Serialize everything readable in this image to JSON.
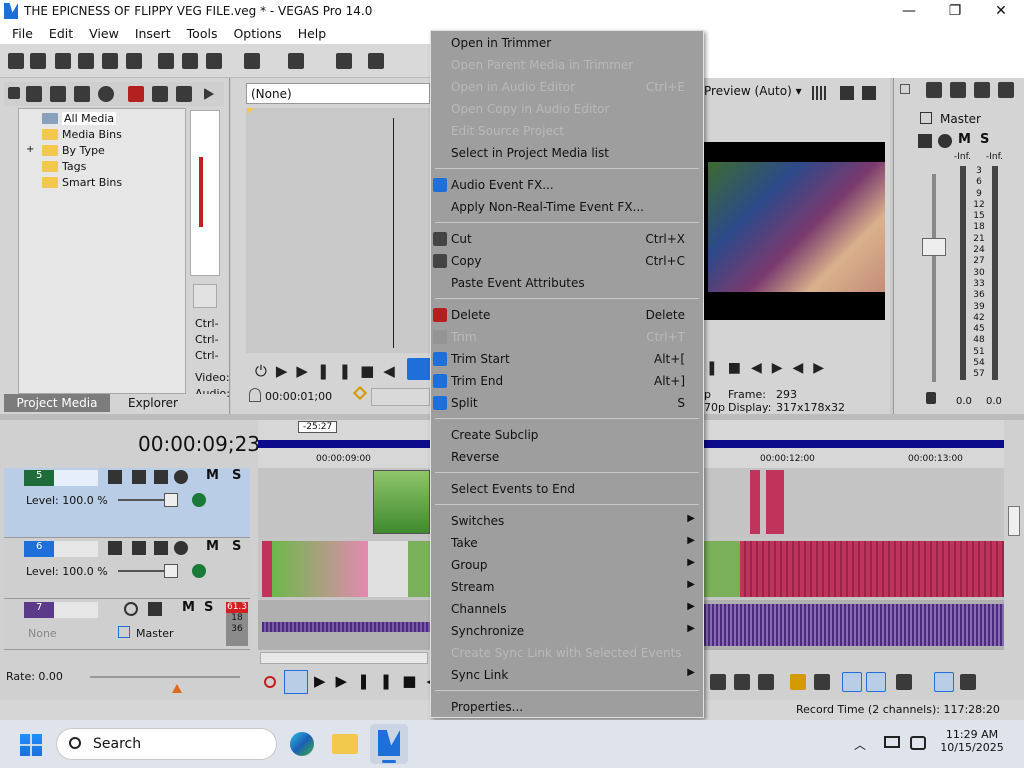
{
  "window": {
    "title": "THE EPICNESS OF FLIPPY VEG FILE.veg * - VEGAS Pro 14.0",
    "minimize": "—",
    "maximize": "❐",
    "close": "✕"
  },
  "menubar": [
    "File",
    "Edit",
    "View",
    "Insert",
    "Tools",
    "Options",
    "Help"
  ],
  "explorer": {
    "tree": [
      "All Media",
      "Media Bins",
      "By Type",
      "Tags",
      "Smart Bins"
    ],
    "expander": "+",
    "tabs": {
      "project_media": "Project Media",
      "explorer": "Explorer"
    },
    "side_labels": [
      "Ctrl-",
      "Ctrl-",
      "Ctrl-",
      "Video:",
      "Audio:"
    ]
  },
  "trimmer": {
    "dropdown": "(None)",
    "timecode": "00:00:01;00"
  },
  "preview": {
    "mode": "Preview (Auto)",
    "frame_label": "Frame:",
    "frame_value": "293",
    "display_label": "Display:",
    "display_value": "317x178x32",
    "left_fragment": "p",
    "left_fragment2": "70p"
  },
  "master": {
    "title": "Master",
    "m": "M",
    "s": "S",
    "inf_left": "-Inf.",
    "inf_right": "-Inf.",
    "scale": [
      "3",
      "6",
      "9",
      "12",
      "15",
      "18",
      "21",
      "24",
      "27",
      "30",
      "33",
      "36",
      "39",
      "42",
      "45",
      "48",
      "51",
      "54",
      "57"
    ],
    "bottom_left": "0.0",
    "bottom_right": "0.0"
  },
  "timeline": {
    "timecode": "00:00:09;23",
    "marker": "-25:27",
    "ruler": [
      "00:00:09:00",
      "00:00:12:00",
      "00:00:13:00"
    ],
    "tracks": [
      {
        "num": "5",
        "level": "Level: 100.0 %",
        "m": "M",
        "s": "S"
      },
      {
        "num": "6",
        "level": "Level: 100.0 %",
        "m": "M",
        "s": "S"
      },
      {
        "num": "7",
        "none": "None",
        "master": "Master",
        "m": "M",
        "s": "S",
        "meter": "61.3",
        "meter2": "18",
        "meter3": "36"
      }
    ],
    "rate": "Rate: 0.00",
    "record_time": "Record Time (2 channels): 117:28:20"
  },
  "context_menu": [
    {
      "label": "Open in Trimmer",
      "enabled": true
    },
    {
      "label": "Open Parent Media in Trimmer",
      "enabled": false
    },
    {
      "label": "Open in Audio Editor",
      "shortcut": "Ctrl+E",
      "enabled": false
    },
    {
      "label": "Open Copy in Audio Editor",
      "enabled": false
    },
    {
      "label": "Edit Source Project",
      "enabled": false
    },
    {
      "label": "Select in Project Media list",
      "enabled": true
    },
    {
      "label": "Audio Event FX...",
      "enabled": true,
      "icon": "fx-icon"
    },
    {
      "label": "Apply Non-Real-Time Event FX...",
      "enabled": true
    },
    {
      "label": "Cut",
      "shortcut": "Ctrl+X",
      "enabled": true,
      "icon": "scissors-icon"
    },
    {
      "label": "Copy",
      "shortcut": "Ctrl+C",
      "enabled": true,
      "icon": "copy-icon"
    },
    {
      "label": "Paste Event Attributes",
      "enabled": true
    },
    {
      "label": "Delete",
      "shortcut": "Delete",
      "enabled": true,
      "icon": "delete-icon"
    },
    {
      "label": "Trim",
      "shortcut": "Ctrl+T",
      "enabled": false,
      "icon": "trim-icon"
    },
    {
      "label": "Trim Start",
      "shortcut": "Alt+[",
      "enabled": true,
      "icon": "trim-start-icon"
    },
    {
      "label": "Trim End",
      "shortcut": "Alt+]",
      "enabled": true,
      "icon": "trim-end-icon"
    },
    {
      "label": "Split",
      "shortcut": "S",
      "enabled": true,
      "icon": "split-icon"
    },
    {
      "label": "Create Subclip",
      "enabled": true
    },
    {
      "label": "Reverse",
      "enabled": true
    },
    {
      "label": "Select Events to End",
      "enabled": true
    },
    {
      "label": "Switches",
      "enabled": true,
      "submenu": true
    },
    {
      "label": "Take",
      "enabled": true,
      "submenu": true
    },
    {
      "label": "Group",
      "enabled": true,
      "submenu": true
    },
    {
      "label": "Stream",
      "enabled": true,
      "submenu": true
    },
    {
      "label": "Channels",
      "enabled": true,
      "submenu": true
    },
    {
      "label": "Synchronize",
      "enabled": true,
      "submenu": true
    },
    {
      "label": "Create Sync Link with Selected Events",
      "enabled": false
    },
    {
      "label": "Sync Link",
      "enabled": true,
      "submenu": true
    },
    {
      "label": "Properties...",
      "enabled": true
    }
  ],
  "taskbar": {
    "search": "Search",
    "time": "11:29 AM",
    "date": "10/15/2025"
  },
  "colors": {
    "accent": "#1e6fd9",
    "timeline_blue": "#0b0b8c",
    "clip_pink": "#c0335a",
    "track_selected": "#b9cde6"
  }
}
